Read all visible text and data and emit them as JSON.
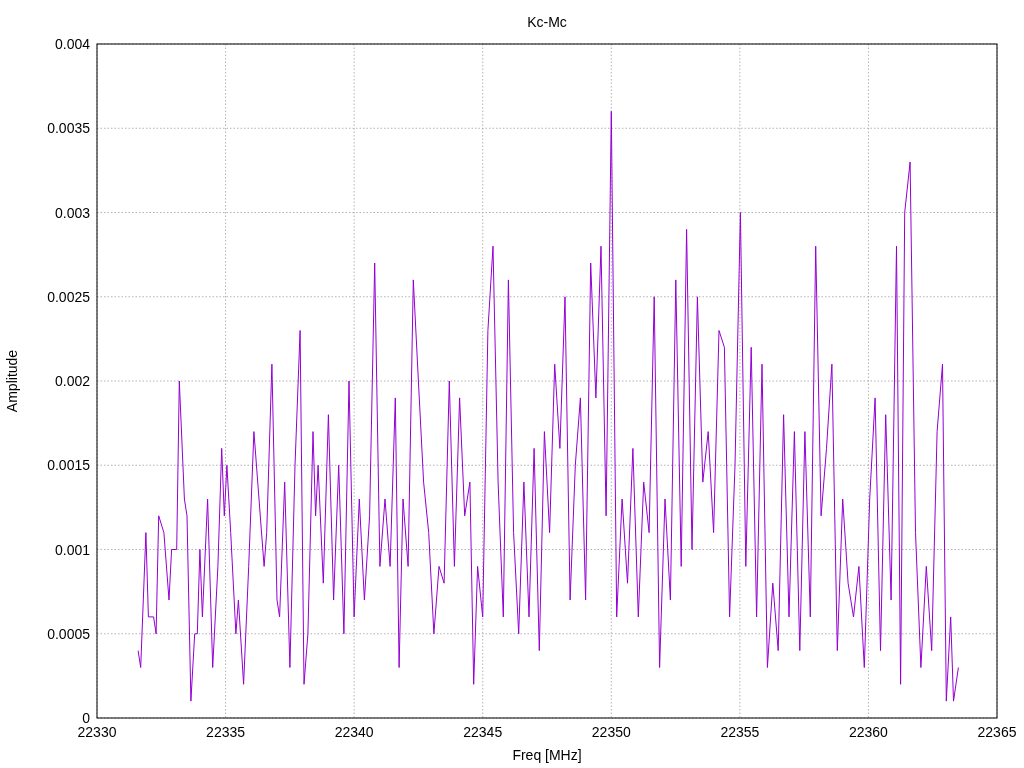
{
  "chart_data": {
    "type": "line",
    "title": "Kc-Mc",
    "xlabel": "Freq [MHz]",
    "ylabel": "Amplitude",
    "grid": true,
    "xlim": [
      22330,
      22365
    ],
    "ylim": [
      0,
      0.004
    ],
    "xticks": [
      22330,
      22335,
      22340,
      22345,
      22350,
      22355,
      22360,
      22365
    ],
    "yticks": [
      0,
      0.0005,
      0.001,
      0.0015,
      0.002,
      0.0025,
      0.003,
      0.0035,
      0.004
    ],
    "x": [
      22331.6,
      22331.7,
      22331.9,
      22332.0,
      22332.2,
      22332.3,
      22332.4,
      22332.6,
      22332.8,
      22332.9,
      22333.1,
      22333.2,
      22333.4,
      22333.5,
      22333.65,
      22333.8,
      22333.9,
      22334.0,
      22334.1,
      22334.3,
      22334.5,
      22334.7,
      22334.85,
      22334.95,
      22335.05,
      22335.2,
      22335.4,
      22335.5,
      22335.7,
      22335.9,
      22336.1,
      22336.3,
      22336.5,
      22336.6,
      22336.8,
      22337.0,
      22337.1,
      22337.3,
      22337.5,
      22337.7,
      22337.9,
      22338.05,
      22338.2,
      22338.4,
      22338.5,
      22338.6,
      22338.8,
      22339.0,
      22339.2,
      22339.4,
      22339.6,
      22339.8,
      22340.0,
      22340.2,
      22340.4,
      22340.6,
      22340.8,
      22341.0,
      22341.2,
      22341.4,
      22341.6,
      22341.75,
      22341.9,
      22342.1,
      22342.3,
      22342.5,
      22342.7,
      22342.9,
      22343.1,
      22343.3,
      22343.5,
      22343.7,
      22343.9,
      22344.1,
      22344.3,
      22344.5,
      22344.65,
      22344.8,
      22345.0,
      22345.2,
      22345.4,
      22345.6,
      22345.8,
      22346.0,
      22346.2,
      22346.4,
      22346.6,
      22346.8,
      22347.0,
      22347.2,
      22347.4,
      22347.6,
      22347.8,
      22348.0,
      22348.2,
      22348.4,
      22348.6,
      22348.8,
      22349.0,
      22349.2,
      22349.4,
      22349.6,
      22349.8,
      22350.0,
      22350.21,
      22350.42,
      22350.63,
      22350.84,
      22351.05,
      22351.26,
      22351.47,
      22351.67,
      22351.88,
      22352.09,
      22352.3,
      22352.51,
      22352.72,
      22352.93,
      22353.14,
      22353.35,
      22353.56,
      22353.77,
      22353.98,
      22354.19,
      22354.4,
      22354.6,
      22354.81,
      22355.02,
      22355.23,
      22355.44,
      22355.65,
      22355.86,
      22356.07,
      22356.28,
      22356.49,
      22356.7,
      22356.91,
      22357.12,
      22357.33,
      22357.53,
      22357.74,
      22357.95,
      22358.16,
      22358.37,
      22358.58,
      22358.79,
      22359.0,
      22359.21,
      22359.42,
      22359.63,
      22359.84,
      22360.05,
      22360.26,
      22360.47,
      22360.67,
      22360.88,
      22361.09,
      22361.25,
      22361.41,
      22361.62,
      22361.83,
      22362.04,
      22362.25,
      22362.46,
      22362.67,
      22362.88,
      22363.03,
      22363.2,
      22363.31,
      22363.5
    ],
    "series": [
      {
        "color": "#9400d3",
        "values": [
          0.0004,
          0.0003,
          0.0011,
          0.0006,
          0.0006,
          0.0005,
          0.0012,
          0.0011,
          0.0007,
          0.001,
          0.001,
          0.002,
          0.0013,
          0.0012,
          0.0001,
          0.0005,
          0.0005,
          0.001,
          0.0006,
          0.0013,
          0.0003,
          0.0009,
          0.0016,
          0.0012,
          0.0015,
          0.0011,
          0.0005,
          0.0007,
          0.0002,
          0.0009,
          0.0017,
          0.0013,
          0.0009,
          0.0011,
          0.0021,
          0.0007,
          0.0006,
          0.0014,
          0.0003,
          0.0015,
          0.0023,
          0.0002,
          0.0005,
          0.0017,
          0.0012,
          0.0015,
          0.0008,
          0.0018,
          0.0007,
          0.0015,
          0.0005,
          0.002,
          0.0006,
          0.0013,
          0.0007,
          0.0012,
          0.0027,
          0.0009,
          0.0013,
          0.0009,
          0.0019,
          0.0003,
          0.0013,
          0.0009,
          0.0026,
          0.002,
          0.0014,
          0.0011,
          0.0005,
          0.0009,
          0.0008,
          0.002,
          0.0009,
          0.0019,
          0.0012,
          0.0014,
          0.0002,
          0.0009,
          0.0006,
          0.0023,
          0.0028,
          0.0014,
          0.0006,
          0.0026,
          0.0011,
          0.0005,
          0.0014,
          0.0006,
          0.0016,
          0.0004,
          0.0017,
          0.0011,
          0.0021,
          0.0016,
          0.0025,
          0.0007,
          0.0015,
          0.0019,
          0.0007,
          0.0027,
          0.0019,
          0.0028,
          0.0012,
          0.0036,
          0.0006,
          0.0013,
          0.0008,
          0.0016,
          0.0006,
          0.0014,
          0.0011,
          0.0025,
          0.0003,
          0.0013,
          0.0007,
          0.0026,
          0.0009,
          0.0029,
          0.001,
          0.0025,
          0.0014,
          0.0017,
          0.0011,
          0.0023,
          0.0022,
          0.0006,
          0.0015,
          0.003,
          0.0009,
          0.0022,
          0.0006,
          0.0021,
          0.0003,
          0.0008,
          0.0004,
          0.0018,
          0.0006,
          0.0017,
          0.0004,
          0.0017,
          0.0006,
          0.0028,
          0.0012,
          0.0016,
          0.0021,
          0.0004,
          0.0013,
          0.0008,
          0.0006,
          0.0009,
          0.0003,
          0.0013,
          0.0019,
          0.0004,
          0.0018,
          0.0007,
          0.0028,
          0.0002,
          0.003,
          0.0033,
          0.0011,
          0.0003,
          0.0009,
          0.0004,
          0.0017,
          0.0021,
          0.0001,
          0.0006,
          0.0001,
          0.0003
        ]
      }
    ]
  }
}
